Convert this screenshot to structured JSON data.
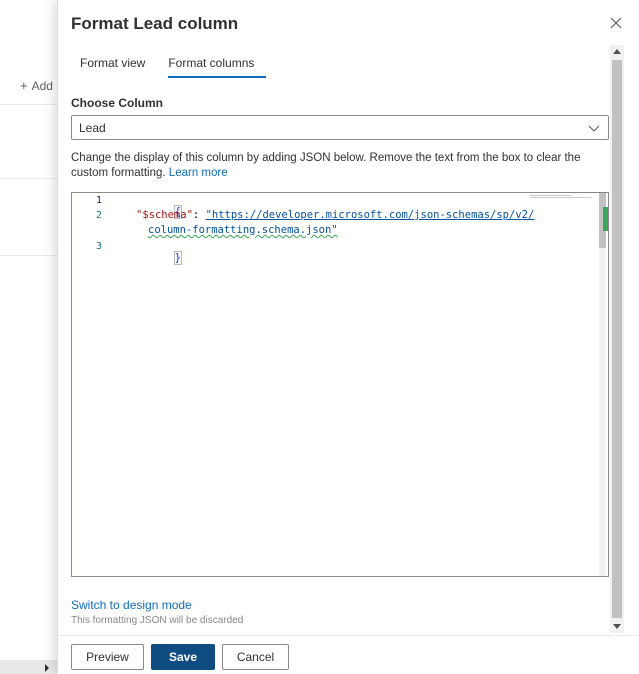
{
  "background": {
    "add_label": "Add",
    "add_icon": "plus-icon"
  },
  "panel": {
    "title": "Format Lead column",
    "close_icon": "close-icon",
    "tabs": [
      {
        "label": "Format view",
        "active": false
      },
      {
        "label": "Format columns",
        "active": true
      }
    ],
    "choose_column_label": "Choose Column",
    "choose_column_value": "Lead",
    "description": "Change the display of this column by adding JSON below. Remove the text from the box to clear the custom formatting.",
    "learn_more": "Learn more",
    "editor": {
      "line_numbers": [
        "1",
        "2",
        "3"
      ],
      "line1": "{",
      "line2_key": "\"$schema\"",
      "line2_colon": ": ",
      "line2_value_part1": "\"https://developer.microsoft.com/json-schemas/sp/v2/",
      "line2_value_part2": "column-formatting.schema.json\"",
      "line3": "}"
    },
    "switch_link": "Switch to design mode",
    "switch_note": "This formatting JSON will be discarded",
    "buttons": {
      "preview": "Preview",
      "save": "Save",
      "cancel": "Cancel"
    }
  },
  "colors": {
    "accent": "#0f6cbd",
    "primary_button": "#0f4c81"
  }
}
